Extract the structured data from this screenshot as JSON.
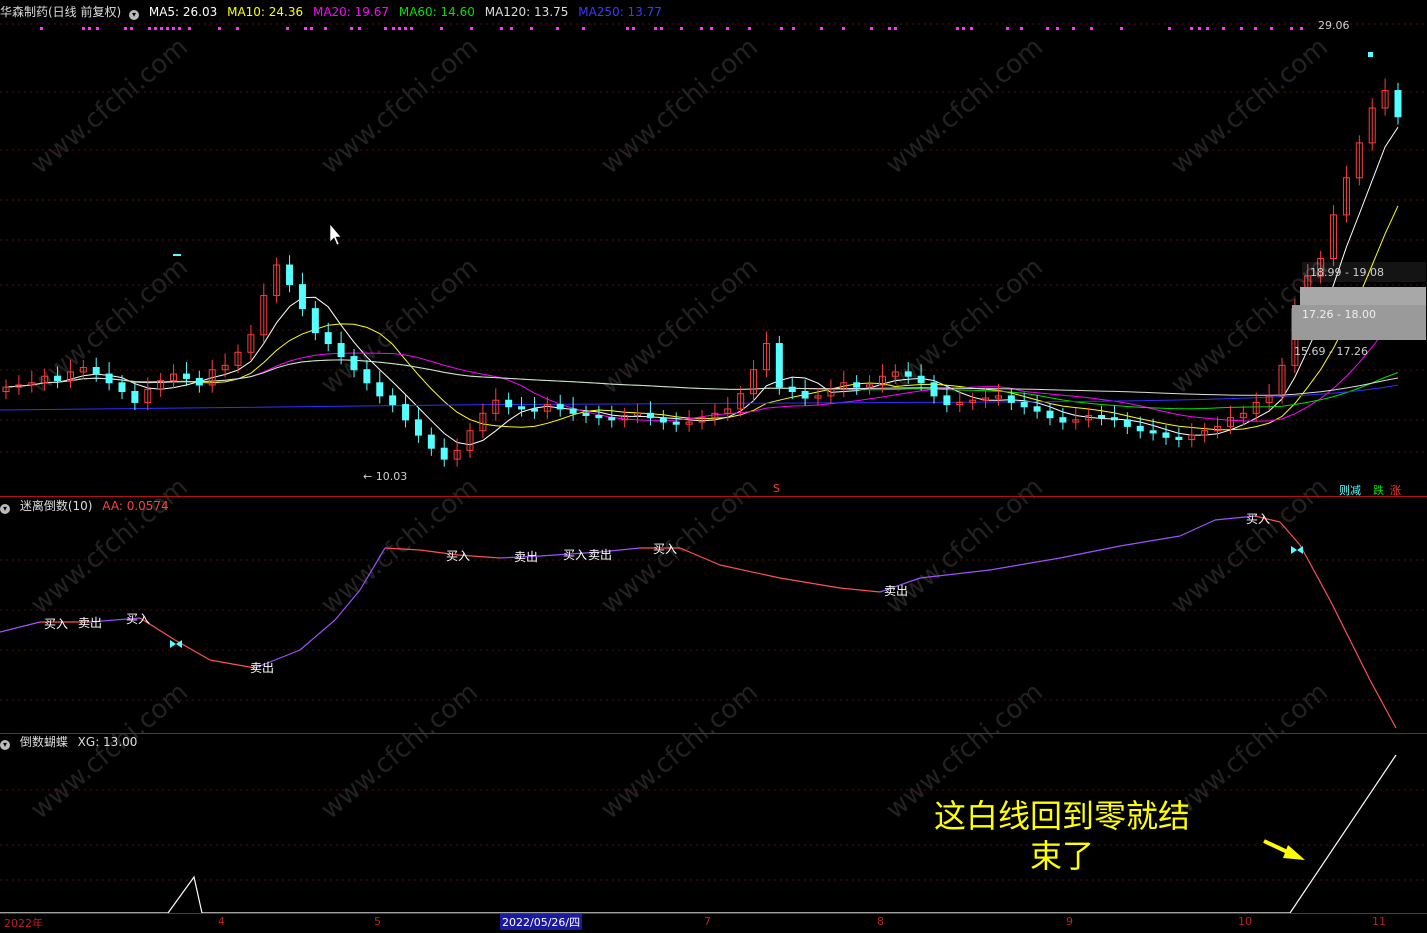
{
  "main_legend": {
    "title": "华森制药(日线 前复权)",
    "ma5": "MA5: 26.03",
    "ma10": "MA10: 24.36",
    "ma20": "MA20: 19.67",
    "ma60": "MA60: 14.60",
    "ma120": "MA120: 13.75",
    "ma250": "MA250: 13.77"
  },
  "colors": {
    "background": "#000000",
    "up_candle": "#ff3b3b",
    "down_candle": "#54ffff",
    "ma5": "#ffffff",
    "ma10": "#ffff00",
    "ma20": "#ff00ff",
    "ma60": "#00e000",
    "ma120": "#dddddd",
    "ma250": "#3030ff",
    "panel_separator": "#b01010",
    "annotation": "#ffff00"
  },
  "price_marks": {
    "high_label": "29.06",
    "low_label": "10.03"
  },
  "price_boxes": {
    "box1": "18.99 - 19.08",
    "box2": "17.26 - 18.00",
    "box3": "15.69 - 17.26"
  },
  "right_tags": {
    "a": "则减",
    "b": "跌",
    "c": "涨"
  },
  "s_marker": "S",
  "indicator1": {
    "title": "迷离倒数(10)",
    "value": "AA: 0.0574",
    "labels": [
      {
        "text": "买入",
        "x": 56,
        "y": 625
      },
      {
        "text": "卖出",
        "x": 90,
        "y": 624
      },
      {
        "text": "买入",
        "x": 138,
        "y": 620
      },
      {
        "text": "卖出",
        "x": 262,
        "y": 669
      },
      {
        "text": "买入",
        "x": 458,
        "y": 557
      },
      {
        "text": "卖出",
        "x": 526,
        "y": 558
      },
      {
        "text": "买入",
        "x": 575,
        "y": 556
      },
      {
        "text": "卖出",
        "x": 600,
        "y": 556
      },
      {
        "text": "买入",
        "x": 665,
        "y": 550
      },
      {
        "text": "卖出",
        "x": 896,
        "y": 592
      },
      {
        "text": "买入",
        "x": 1258,
        "y": 520
      }
    ]
  },
  "indicator2": {
    "title": "倒数蝴蝶",
    "value": "XG: 13.00"
  },
  "annotation": {
    "line1": "这白线回到零就结",
    "line2": "束了"
  },
  "date_axis": {
    "year": "2022年",
    "m4": "4",
    "m5": "5",
    "cursor_date": "2022/05/26/四",
    "m7": "7",
    "m8": "8",
    "m9": "9",
    "m10": "10",
    "m11": "11"
  },
  "chart_data": {
    "type": "line",
    "candle_closes_approx": [
      13.6,
      13.7,
      13.8,
      14.1,
      13.9,
      14.3,
      14.5,
      14.2,
      13.8,
      13.4,
      12.9,
      13.5,
      13.9,
      14.2,
      14.0,
      13.7,
      14.4,
      14.6,
      15.2,
      16.0,
      17.8,
      19.2,
      18.3,
      17.2,
      16.1,
      15.6,
      15.0,
      14.4,
      13.8,
      13.2,
      12.8,
      12.1,
      11.4,
      10.8,
      10.3,
      10.7,
      11.6,
      12.4,
      13.0,
      12.7,
      12.6,
      12.5,
      12.8,
      12.6,
      12.4,
      12.3,
      12.2,
      12.1,
      12.3,
      12.4,
      12.2,
      12.0,
      11.9,
      12.0,
      12.2,
      12.4,
      12.6,
      13.3,
      14.4,
      15.6,
      13.6,
      13.4,
      13.1,
      13.2,
      13.5,
      13.8,
      13.6,
      13.7,
      14.1,
      14.3,
      14.1,
      13.8,
      13.2,
      12.8,
      12.9,
      13.0,
      13.1,
      13.2,
      12.9,
      12.7,
      12.5,
      12.2,
      12.0,
      12.1,
      12.3,
      12.2,
      12.1,
      11.8,
      11.6,
      11.5,
      11.3,
      11.2,
      11.4,
      11.6,
      11.8,
      12.2,
      12.4,
      12.9,
      13.2,
      14.6,
      17.2,
      18.7,
      19.5,
      21.5,
      23.2,
      24.8,
      26.4,
      27.2,
      26.0
    ],
    "ylim": [
      10.03,
      29.06
    ]
  }
}
